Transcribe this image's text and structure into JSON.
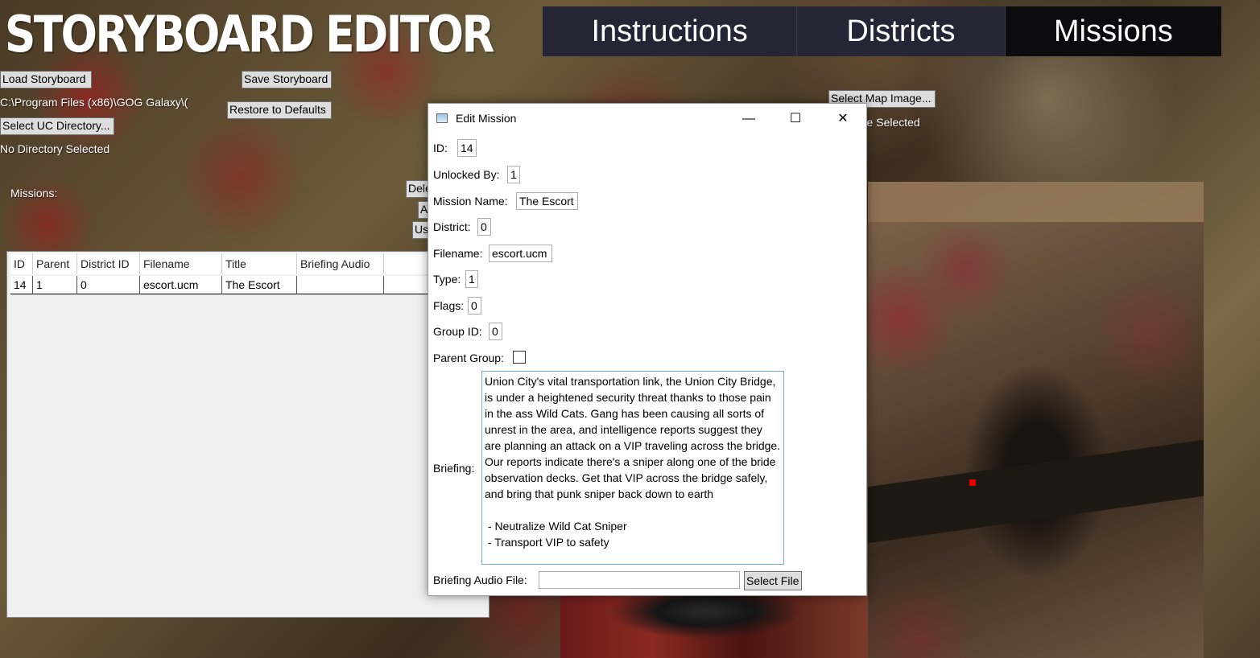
{
  "app": {
    "title": "STORYBOARD EDITOR"
  },
  "nav": {
    "tabs": [
      {
        "label": "Instructions",
        "active": false
      },
      {
        "label": "Districts",
        "active": false
      },
      {
        "label": "Missions",
        "active": true
      }
    ]
  },
  "toolbar": {
    "load_label": "Load Storyboard",
    "save_label": "Save Storyboard",
    "restore_label": "Restore to Defaults",
    "select_dir_label": "Select UC Directory...",
    "path_text": "C:\\Program Files (x86)\\GOG Galaxy\\(",
    "dir_status": "No Directory Selected",
    "select_map_label": "Select Map Image...",
    "map_status": "No File Selected"
  },
  "missions_panel": {
    "label": "Missions:",
    "side_buttons": [
      "Dele",
      "A",
      "Us"
    ],
    "columns": [
      "ID",
      "Parent",
      "District ID",
      "Filename",
      "Title",
      "Briefing Audio"
    ],
    "rows": [
      {
        "id": "14",
        "parent": "1",
        "district": "0",
        "filename": "escort.ucm",
        "title": "The Escort",
        "audio": ""
      }
    ]
  },
  "dialog": {
    "title": "Edit Mission",
    "fields": {
      "id_label": "ID:",
      "id_value": "14",
      "unlocked_label": "Unlocked By:",
      "unlocked_value": "1",
      "name_label": "Mission Name:",
      "name_value": "The Escort",
      "district_label": "District:",
      "district_value": "0",
      "filename_label": "Filename:",
      "filename_value": "escort.ucm",
      "type_label": "Type:",
      "type_value": "1",
      "flags_label": "Flags:",
      "flags_value": "0",
      "group_label": "Group ID:",
      "group_value": "0",
      "parent_group_label": "Parent Group:",
      "parent_group_checked": false,
      "briefing_label": "Briefing:",
      "briefing_text": "Union City's vital transportation link, the Union City Bridge, is under a heightened security threat thanks to those pain in the ass Wild Cats. Gang has been causing all sorts of unrest in the area, and intelligence reports suggest they are planning an attack on a VIP traveling across the bridge. Our reports indicate there's a sniper along one of the bride observation decks. Get that VIP across the bridge safely, and bring that punk sniper back down to earth\n\n - Neutralize Wild Cat Sniper\n - Transport VIP to safety",
      "audio_label": "Briefing Audio File:",
      "audio_value": "",
      "select_file_label": "Select File"
    },
    "controls": {
      "minimize": "—",
      "maximize": "☐",
      "close": "✕"
    }
  },
  "colors": {
    "nav_bg": "#252536",
    "nav_active": "#0c0c0e",
    "marker": "#e00000"
  }
}
